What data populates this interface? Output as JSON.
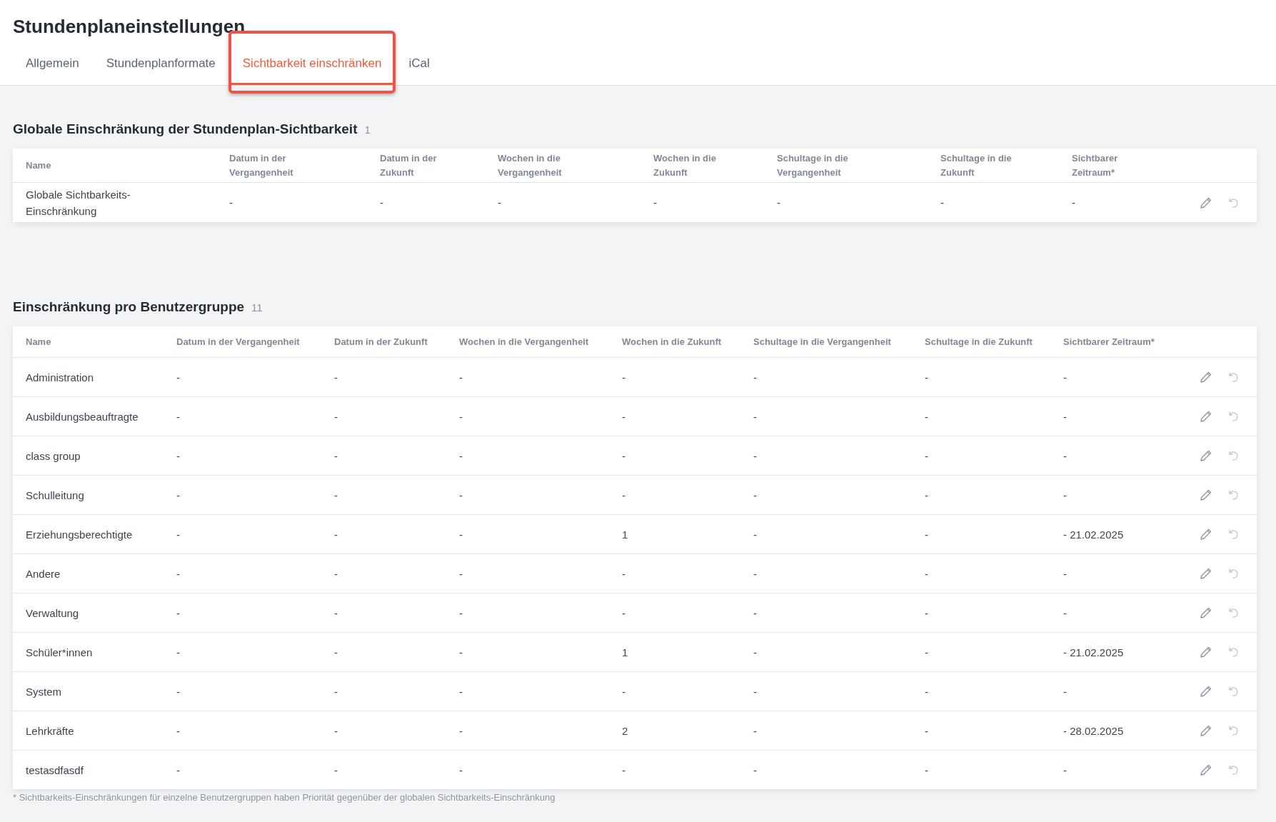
{
  "page_title": "Stundenplaneinstellungen",
  "tabs": [
    {
      "label": "Allgemein",
      "selected": false,
      "highlighted": false
    },
    {
      "label": "Stundenplanformate",
      "selected": false,
      "highlighted": false
    },
    {
      "label": "Sichtbarkeit einschränken",
      "selected": true,
      "highlighted": true
    },
    {
      "label": "iCal",
      "selected": false,
      "highlighted": false
    }
  ],
  "sections": [
    {
      "kind": "global",
      "title": "Globale Einschränkung der Stundenplan-Sichtbarkeit",
      "count": "1",
      "columns": [
        "Name",
        "Datum in der Vergangenheit",
        "Datum in der Zukunft",
        "Wochen in die Vergangenheit",
        "Wochen in die Zukunft",
        "Schultage in die Vergangenheit",
        "Schultage in die Zukunft",
        "Sichtbarer Zeitraum*"
      ],
      "rows": [
        [
          "Globale Sichtbarkeits-Einschränkung",
          "-",
          "-",
          "-",
          "-",
          "-",
          "-",
          "-"
        ]
      ]
    },
    {
      "kind": "groups",
      "title": "Einschränkung pro Benutzergruppe",
      "count": "11",
      "columns": [
        "Name",
        "Datum in der Vergangenheit",
        "Datum in der Zukunft",
        "Wochen in die Vergangenheit",
        "Wochen in die Zukunft",
        "Schultage in die Vergangenheit",
        "Schultage in die Zukunft",
        "Sichtbarer Zeitraum*"
      ],
      "rows": [
        [
          "Administration",
          "-",
          "-",
          "-",
          "-",
          "-",
          "-",
          "-"
        ],
        [
          "Ausbildungsbeauftragte",
          "-",
          "-",
          "-",
          "-",
          "-",
          "-",
          "-"
        ],
        [
          "class group",
          "-",
          "-",
          "-",
          "-",
          "-",
          "-",
          "-"
        ],
        [
          "Schulleitung",
          "-",
          "-",
          "-",
          "-",
          "-",
          "-",
          "-"
        ],
        [
          "Erziehungsberechtigte",
          "-",
          "-",
          "-",
          "1",
          "-",
          "-",
          "- 21.02.2025"
        ],
        [
          "Andere",
          "-",
          "-",
          "-",
          "-",
          "-",
          "-",
          "-"
        ],
        [
          "Verwaltung",
          "-",
          "-",
          "-",
          "-",
          "-",
          "-",
          "-"
        ],
        [
          "Schüler*innen",
          "-",
          "-",
          "-",
          "1",
          "-",
          "-",
          "- 21.02.2025"
        ],
        [
          "System",
          "-",
          "-",
          "-",
          "-",
          "-",
          "-",
          "-"
        ],
        [
          "Lehrkräfte",
          "-",
          "-",
          "-",
          "2",
          "-",
          "-",
          "- 28.02.2025"
        ],
        [
          "testasdfasdf",
          "-",
          "-",
          "-",
          "-",
          "-",
          "-",
          "-"
        ]
      ]
    }
  ],
  "footnote": "* Sichtbarkeits-Einschränkungen für einzelne Benutzergruppen haben Priorität gegenüber der globalen Sichtbarkeits-Einschränkung"
}
